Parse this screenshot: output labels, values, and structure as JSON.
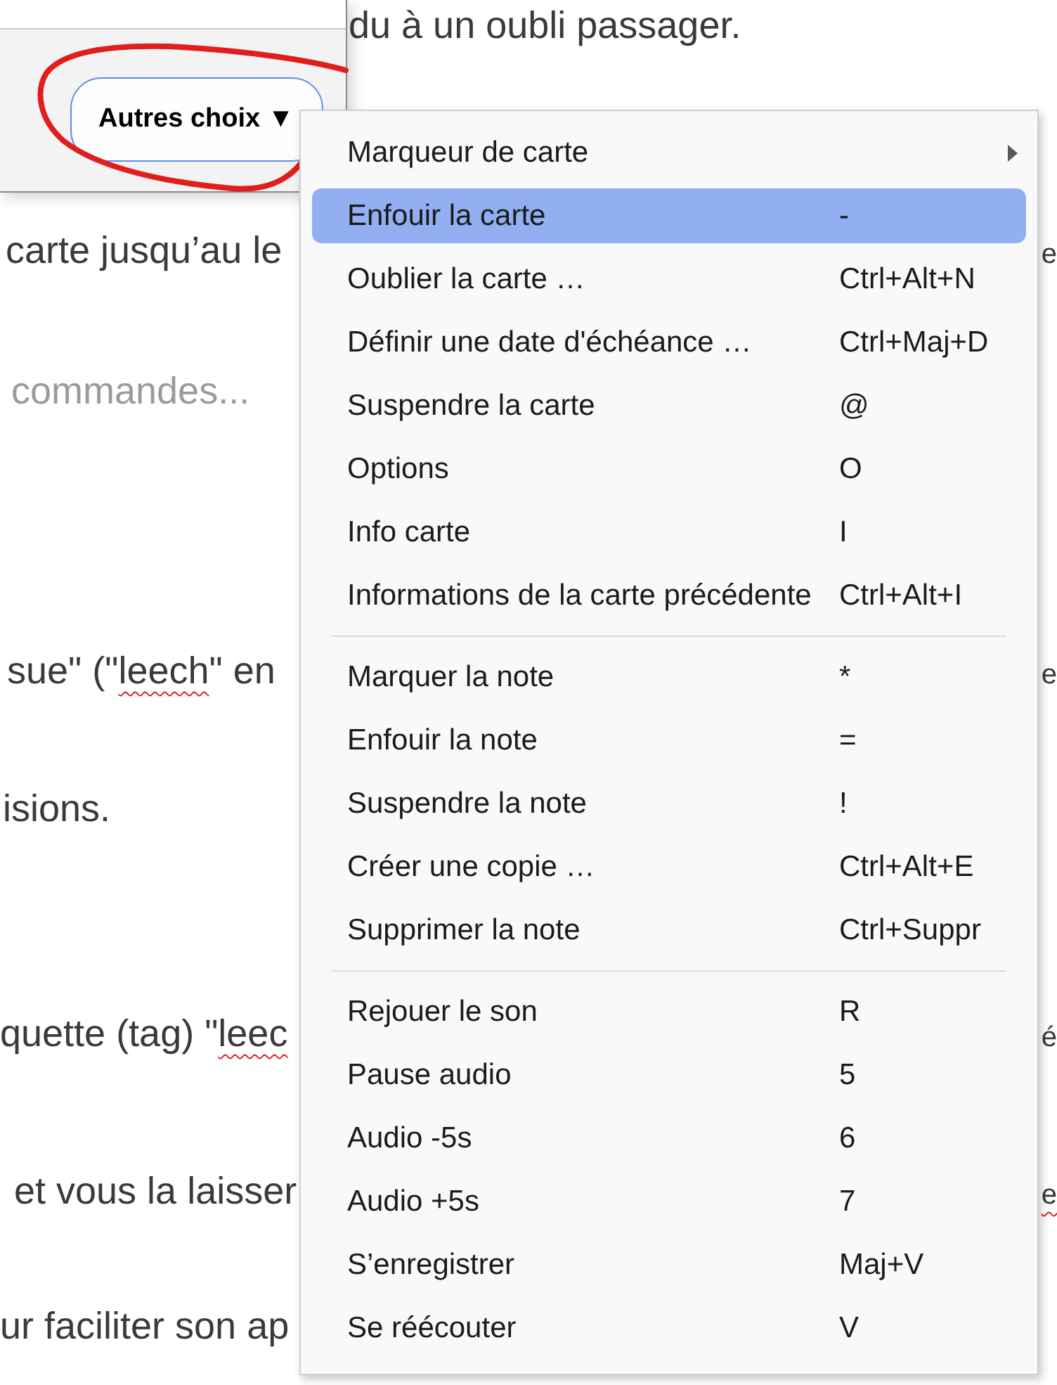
{
  "document": {
    "lines": [
      {
        "dimmed": false,
        "segments": [
          {
            "text": "du à un oubli passager.",
            "misspelled": false
          }
        ]
      },
      {
        "dimmed": false,
        "segments": [
          {
            "text": "carte jusqu’au le",
            "misspelled": false
          }
        ],
        "right_segments": [
          {
            "text": "e",
            "misspelled": false
          }
        ]
      },
      {
        "dimmed": true,
        "segments": [
          {
            "text": "commandes...",
            "misspelled": false
          }
        ]
      },
      {
        "dimmed": false,
        "segments": [
          {
            "text": "sue\" (\"",
            "misspelled": false
          },
          {
            "text": "leech",
            "misspelled": true
          },
          {
            "text": "\" en",
            "misspelled": false
          }
        ],
        "right_segments": [
          {
            "text": "e",
            "misspelled": false
          }
        ]
      },
      {
        "dimmed": false,
        "segments": [
          {
            "text": "isions.",
            "misspelled": false
          }
        ]
      },
      {
        "dimmed": false,
        "segments": [
          {
            "text": "quette (tag) \"",
            "misspelled": false
          },
          {
            "text": "leec",
            "misspelled": true
          }
        ],
        "right_segments": [
          {
            "text": "é",
            "misspelled": false
          }
        ]
      },
      {
        "dimmed": false,
        "segments": [
          {
            "text": "et vous la laisser",
            "misspelled": false
          }
        ],
        "right_segments": [
          {
            "text": "e",
            "misspelled": true
          }
        ]
      },
      {
        "dimmed": false,
        "segments": [
          {
            "text": "ur faciliter son ap",
            "misspelled": false
          }
        ]
      }
    ]
  },
  "dialog": {
    "button": {
      "label": "Autres choix ▼"
    }
  },
  "annotation": {
    "kind": "loop"
  },
  "context_menu": {
    "sections": [
      [
        {
          "label": "Marqueur de carte",
          "submenu": true,
          "selected": false
        },
        {
          "label": "Enfouir la carte",
          "shortcut": "-",
          "submenu": false,
          "selected": true
        },
        {
          "label": "Oublier la carte …",
          "shortcut": "Ctrl+Alt+N",
          "submenu": false,
          "selected": false
        },
        {
          "label": "Définir une date d'échéance …",
          "shortcut": "Ctrl+Maj+D",
          "submenu": false,
          "selected": false
        },
        {
          "label": "Suspendre la carte",
          "shortcut": "@",
          "submenu": false,
          "selected": false
        },
        {
          "label": "Options",
          "shortcut": "O",
          "submenu": false,
          "selected": false
        },
        {
          "label": "Info carte",
          "shortcut": "I",
          "submenu": false,
          "selected": false
        },
        {
          "label": "Informations de la carte précédente",
          "shortcut": "Ctrl+Alt+I",
          "submenu": false,
          "selected": false
        }
      ],
      [
        {
          "label": "Marquer la note",
          "shortcut": "*",
          "submenu": false,
          "selected": false
        },
        {
          "label": "Enfouir la note",
          "shortcut": "=",
          "submenu": false,
          "selected": false
        },
        {
          "label": "Suspendre la note",
          "shortcut": "!",
          "submenu": false,
          "selected": false
        },
        {
          "label": "Créer une copie …",
          "shortcut": "Ctrl+Alt+E",
          "submenu": false,
          "selected": false
        },
        {
          "label": "Supprimer la note",
          "shortcut": "Ctrl+Suppr",
          "submenu": false,
          "selected": false
        }
      ],
      [
        {
          "label": "Rejouer le son",
          "shortcut": "R",
          "submenu": false,
          "selected": false
        },
        {
          "label": "Pause audio",
          "shortcut": "5",
          "submenu": false,
          "selected": false
        },
        {
          "label": "Audio -5s",
          "shortcut": "6",
          "submenu": false,
          "selected": false
        },
        {
          "label": "Audio +5s",
          "shortcut": "7",
          "submenu": false,
          "selected": false
        },
        {
          "label": "S’enregistrer",
          "shortcut": "Maj+V",
          "submenu": false,
          "selected": false
        },
        {
          "label": "Se réécouter",
          "shortcut": "V",
          "submenu": false,
          "selected": false
        }
      ]
    ]
  }
}
